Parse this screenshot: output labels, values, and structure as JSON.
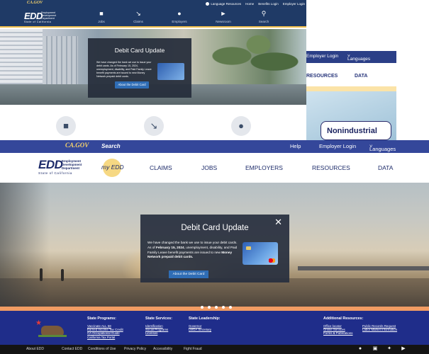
{
  "colors": {
    "navy": "#1f3a66",
    "nav_blue": "#34479a",
    "footer_blue": "#1f2d8a",
    "accent_orange": "#f19c63",
    "button_blue": "#2f6db5",
    "gold": "#f7d36b"
  },
  "back_window": {
    "gov_logo": "CA.GOV",
    "top_links": [
      "Language Resources",
      "Home",
      "Benefits Login",
      "Employer Login"
    ],
    "logo": {
      "edd": "EDD",
      "sub": [
        "Employment",
        "Development",
        "Department"
      ],
      "state": "State of California"
    },
    "nav": [
      {
        "label": "Jobs",
        "icon": "briefcase-icon"
      },
      {
        "label": "Claims",
        "icon": "claims-icon"
      },
      {
        "label": "Employers",
        "icon": "people-icon"
      },
      {
        "label": "Newsroom",
        "icon": "megaphone-icon"
      },
      {
        "label": "Search",
        "icon": "search-icon"
      }
    ],
    "modal": {
      "title": "Debit Card Update",
      "text": "We have changed the bank we use to issue your debit cards. As of February 15, 2024, unemployment, disability, and Paid Family Leave benefit payments are issued to new Money Network prepaid debit cards.",
      "button": "About the Debit Card"
    },
    "circle_icons": [
      "briefcase-icon",
      "claims-icon",
      "people-icon"
    ]
  },
  "mid_window": {
    "nav": [
      "Employer Login",
      "Languages"
    ],
    "links": [
      "RESOURCES",
      "DATA"
    ],
    "card_button": "Nonindustrial"
  },
  "front_window": {
    "gov_logo": "CA.GOV",
    "search": "Search",
    "utility": [
      "Help",
      "Employer Login",
      "Languages"
    ],
    "logo": {
      "edd": "EDD",
      "sub": [
        "Employment",
        "Development",
        "Department"
      ],
      "state": "State of California"
    },
    "my_edd": "my EDD",
    "nav": [
      "CLAIMS",
      "JOBS",
      "EMPLOYERS",
      "RESOURCES",
      "DATA"
    ],
    "modal": {
      "title": "Debit Card Update",
      "text_1": "We have changed the bank we use to issue your debit cards. As of ",
      "date": "February 15, 2024",
      "text_2": ", unemployment, disability, and Paid Family Leave benefit payments are issued to new ",
      "bold_end": "Money Network prepaid debit cards.",
      "button": "About the Debit Card"
    },
    "carousel_pages": 5,
    "footer": {
      "programs": {
        "title": "State Programs:",
        "links": [
          "Vaccinate ALL 58",
          "Earned Income Tax Credit",
          "CA Occupational Guide",
          "California Tax Portal"
        ]
      },
      "services": {
        "title": "State Services:",
        "links": [
          "Identification",
          "Social Programs",
          "Licenses"
        ]
      },
      "leadership": {
        "title": "State Leadership:",
        "links": [
          "Governor",
          "LWDA Secretary"
        ]
      },
      "additional": {
        "title": "Additional Resources:",
        "links_a": [
          "Office locator",
          "Online Services",
          "Forms & Publications"
        ],
        "links_b": [
          "Public Records Request",
          "Labor Market Information"
        ]
      }
    },
    "bottom_links": [
      "About EDD",
      "Contact EDD",
      "Conditions of Use",
      "Privacy Policy",
      "Accessibility",
      "Fight Fraud"
    ],
    "social": [
      "facebook-icon",
      "instagram-icon",
      "twitter-icon",
      "youtube-icon"
    ]
  }
}
